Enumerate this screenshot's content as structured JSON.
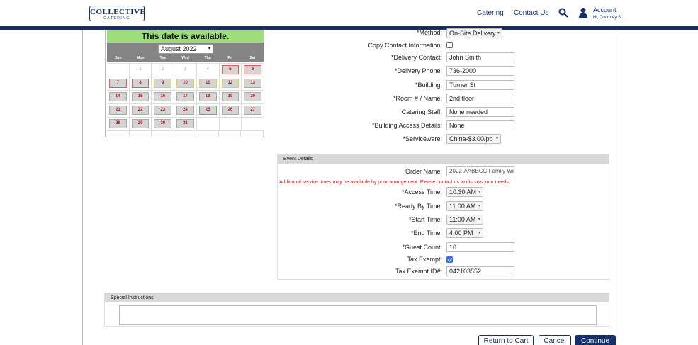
{
  "header": {
    "logo_line1": "COLLECTIVE",
    "logo_line2": "CATERING",
    "nav": [
      "Catering",
      "Contact Us"
    ],
    "account_title": "Account",
    "account_sub": "Hi, Courtney S...",
    "icons": [
      "search-icon",
      "user-icon"
    ]
  },
  "calendar": {
    "availability": "This date is available.",
    "month_select": "August 2022",
    "weekdays": [
      "Sun",
      "Mon",
      "Tue",
      "Wed",
      "Thu",
      "Fri",
      "Sat"
    ],
    "weeks": [
      [
        {
          "d": "",
          "s": "past"
        },
        {
          "d": "1",
          "s": "past"
        },
        {
          "d": "2",
          "s": "past"
        },
        {
          "d": "3",
          "s": "past"
        },
        {
          "d": "4",
          "s": "past"
        },
        {
          "d": "5",
          "s": "red"
        },
        {
          "d": "6",
          "s": "red"
        }
      ],
      [
        {
          "d": "7",
          "s": "red"
        },
        {
          "d": "8",
          "s": "red"
        },
        {
          "d": "9",
          "s": "yellow"
        },
        {
          "d": "10",
          "s": "yellow"
        },
        {
          "d": "11",
          "s": "yellow"
        },
        {
          "d": "12",
          "s": "yellow"
        },
        {
          "d": "13",
          "s": "normal"
        }
      ],
      [
        {
          "d": "14",
          "s": "normal"
        },
        {
          "d": "15",
          "s": "normal"
        },
        {
          "d": "16",
          "s": "normal"
        },
        {
          "d": "17",
          "s": "normal"
        },
        {
          "d": "18",
          "s": "normal"
        },
        {
          "d": "19",
          "s": "normal"
        },
        {
          "d": "20",
          "s": "normal"
        }
      ],
      [
        {
          "d": "21",
          "s": "normal"
        },
        {
          "d": "22",
          "s": "normal"
        },
        {
          "d": "23",
          "s": "normal"
        },
        {
          "d": "24",
          "s": "normal"
        },
        {
          "d": "25",
          "s": "green"
        },
        {
          "d": "26",
          "s": "normal"
        },
        {
          "d": "27",
          "s": "normal"
        }
      ],
      [
        {
          "d": "28",
          "s": "normal"
        },
        {
          "d": "29",
          "s": "normal"
        },
        {
          "d": "30",
          "s": "normal"
        },
        {
          "d": "31",
          "s": "normal"
        },
        {
          "d": "",
          "s": "empty"
        },
        {
          "d": "",
          "s": "empty"
        },
        {
          "d": "",
          "s": "empty"
        }
      ]
    ]
  },
  "delivery": {
    "method_label": "*Method:",
    "method_value": "On-Site Delivery",
    "copy_label": "Copy Contact Information:",
    "contact_label": "*Delivery Contact:",
    "contact_value": "John Smith",
    "phone_label": "*Delivery Phone:",
    "phone_value": "736-2000",
    "building_label": "*Building:",
    "building_value": "Turner St",
    "room_label": "*Room # / Name:",
    "room_value": "2nd floor",
    "staff_label": "Catering Staff:",
    "staff_value": "None needed",
    "access_label": "*Building Access Details:",
    "access_value": "None",
    "serviceware_label": "*Serviceware:",
    "serviceware_value": "China-$3.00/pp"
  },
  "event": {
    "heading": "Event Details",
    "order_label": "Order Name:",
    "order_value": "2022-AABBCC Family We",
    "notice": "Additional service times may be available by prior arrangement. Please contact us to discuss your needs.",
    "access_time_label": "*Access Time:",
    "access_time_value": "10:30 AM",
    "ready_label": "*Ready By Time:",
    "ready_value": "11:00 AM",
    "start_label": "*Start Time:",
    "start_value": "11:00 AM",
    "end_label": "*End Time:",
    "end_value": "4:00 PM",
    "guest_label": "*Guest Count:",
    "guest_value": "10",
    "tax_label": "Tax Exempt:",
    "tax_checked": true,
    "taxid_label": "Tax Exempt ID#:",
    "taxid_value": "042103552"
  },
  "special": {
    "heading": "Special Instructions",
    "value": ""
  },
  "buttons": {
    "return": "Return to Cart",
    "cancel": "Cancel",
    "continue": "Continue"
  },
  "colors": {
    "brand": "#13306b",
    "available": "#9cde79",
    "notice": "#c41818"
  }
}
